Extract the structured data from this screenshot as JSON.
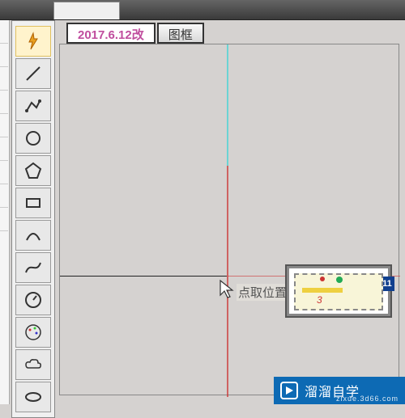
{
  "tabs": [
    {
      "label": "2017.6.12改",
      "active": true
    },
    {
      "label": "图框",
      "active": false
    }
  ],
  "tooltip": "点取位置或",
  "preview": {
    "number": "3",
    "badge": "11"
  },
  "watermark": {
    "brand": "溜溜自学",
    "url": "zixue.3d66.com"
  },
  "tools": [
    "lightning",
    "line",
    "polyline",
    "circle",
    "polygon",
    "rectangle",
    "arc",
    "spline",
    "gauge",
    "color-picker",
    "cloud",
    "ellipse"
  ]
}
